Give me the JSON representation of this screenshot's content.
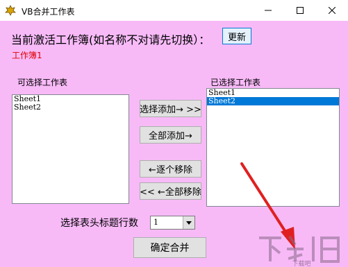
{
  "window": {
    "title": "VB合并工作表",
    "controls": {
      "minimize_icon": "minimize-icon",
      "maximize_icon": "maximize-icon",
      "close_icon": "close-icon"
    }
  },
  "colors": {
    "client_bg": "#f7baf7",
    "selection_bg": "#0078d7",
    "workbook_text": "#e00000",
    "arrow": "#e02020"
  },
  "header": {
    "current_label": "当前激活工作簿(如名称不对请先切换）：",
    "workbook_name": "工作簿1",
    "refresh_label": "更新"
  },
  "available": {
    "label": "可选择工作表",
    "items": [
      "Sheet1",
      "Sheet2"
    ]
  },
  "selected": {
    "label": "已选择工作表",
    "items": [
      "Sheet1",
      "Sheet2"
    ],
    "highlighted_item": "Sheet2"
  },
  "actions": {
    "add_selected": "选择添加→ >>",
    "add_all": "全部添加→",
    "remove_one": "←逐个移除",
    "remove_all": "<< ←全部移除"
  },
  "header_rows": {
    "label": "选择表头标题行数",
    "value": "1"
  },
  "confirm_label": "确定合并",
  "watermark_text": "下载吧"
}
